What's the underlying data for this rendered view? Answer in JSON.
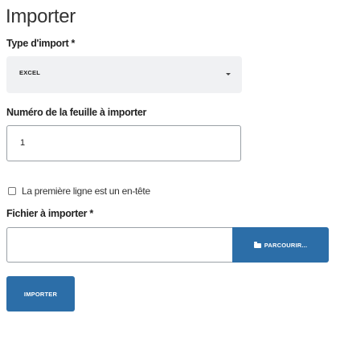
{
  "page": {
    "title": "Importer"
  },
  "form": {
    "import_type": {
      "label": "Type d'import *",
      "selected": "EXCEL"
    },
    "sheet_number": {
      "label": "Numéro de la feuille à importer",
      "value": "1"
    },
    "header_row": {
      "label": "La première ligne est un en-tête",
      "checked": false
    },
    "file": {
      "label": "Fichier à importer *",
      "value": "",
      "browse_label": "PARCOURIR..."
    },
    "submit_label": "IMPORTER"
  },
  "colors": {
    "primary": "#2c6ea8",
    "select_background": "#f0f1f3",
    "input_border": "#9aa0a6"
  },
  "icons": {
    "select_caret": "caret-down-icon",
    "browse": "folder-open-icon"
  }
}
